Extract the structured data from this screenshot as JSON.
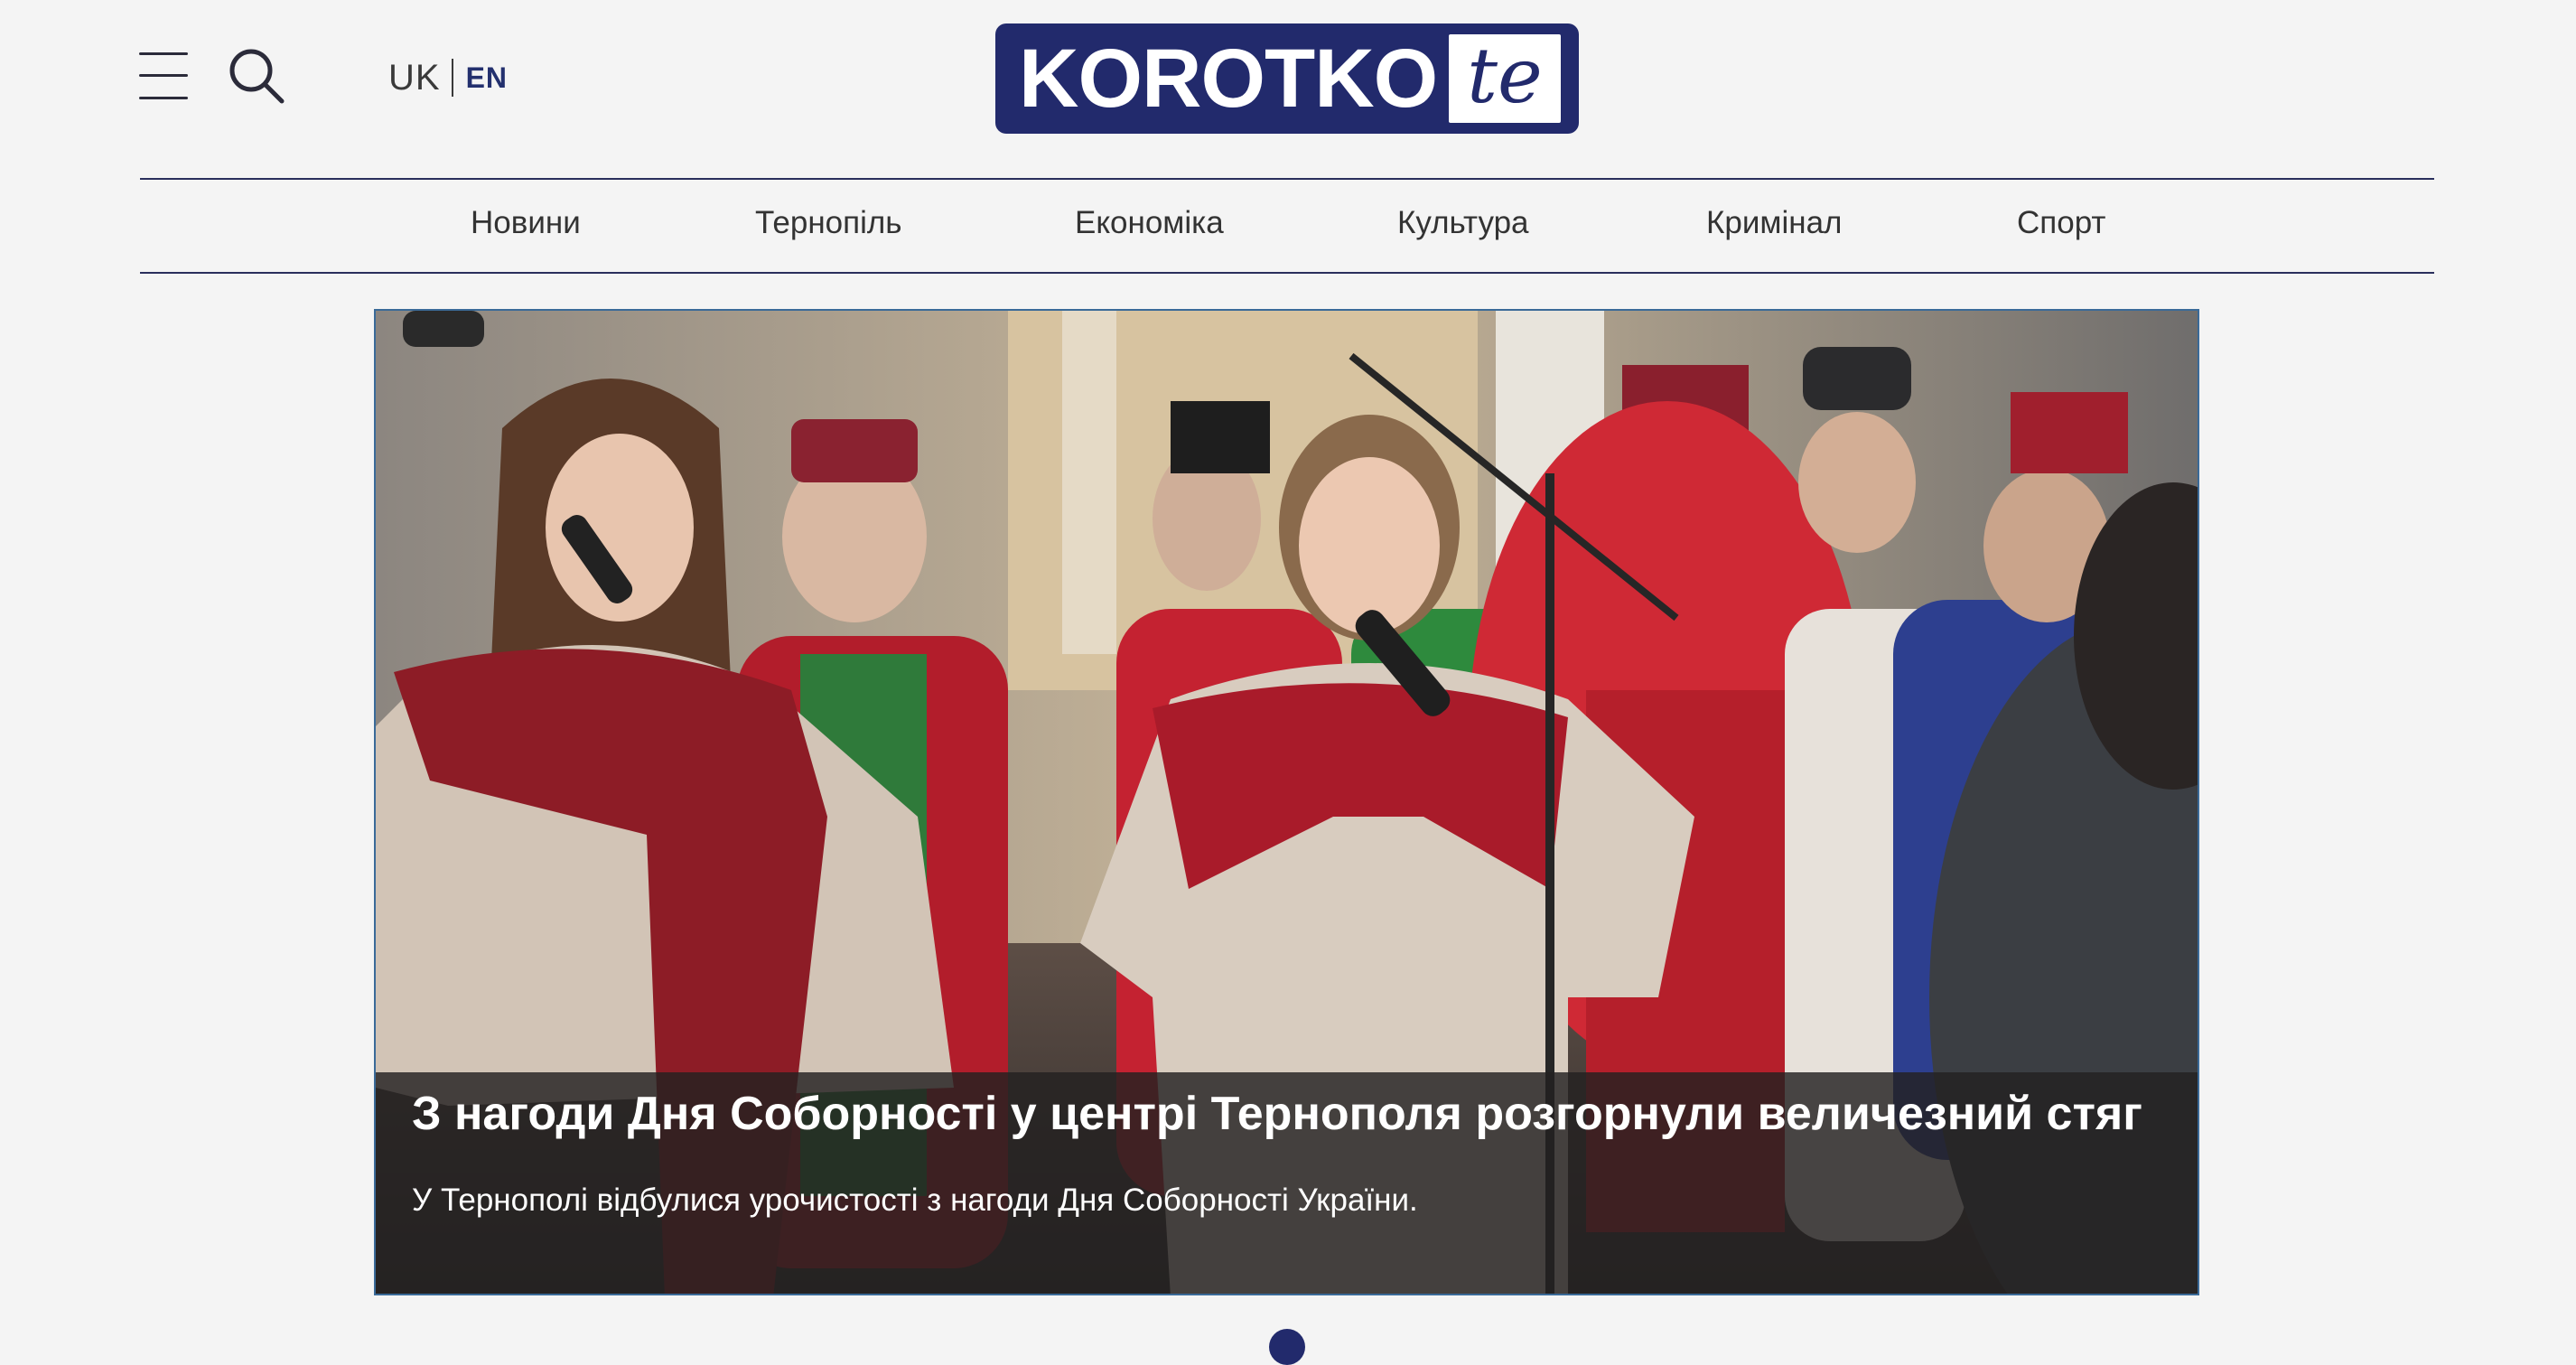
{
  "header": {
    "lang_uk": "UK",
    "lang_en": "EN",
    "logo": {
      "main": "KOROTKO",
      "suffix": "te"
    }
  },
  "nav": {
    "items": [
      {
        "label": "Новини"
      },
      {
        "label": "Тернопіль"
      },
      {
        "label": "Економіка"
      },
      {
        "label": "Культура"
      },
      {
        "label": "Кримінал"
      },
      {
        "label": "Спорт"
      }
    ]
  },
  "hero": {
    "title": "З нагоди Дня Соборності у центрі Тернополя розгорнули величезний стяг",
    "description": "У Тернополі відбулися урочистості з нагоди Дня Соборності України."
  },
  "carousel": {
    "active_index": 1
  },
  "colors": {
    "brand": "#222a6c",
    "page_bg": "#f4f4f4",
    "nav_line": "#2a2f5c",
    "caption_bg": "#232121"
  }
}
